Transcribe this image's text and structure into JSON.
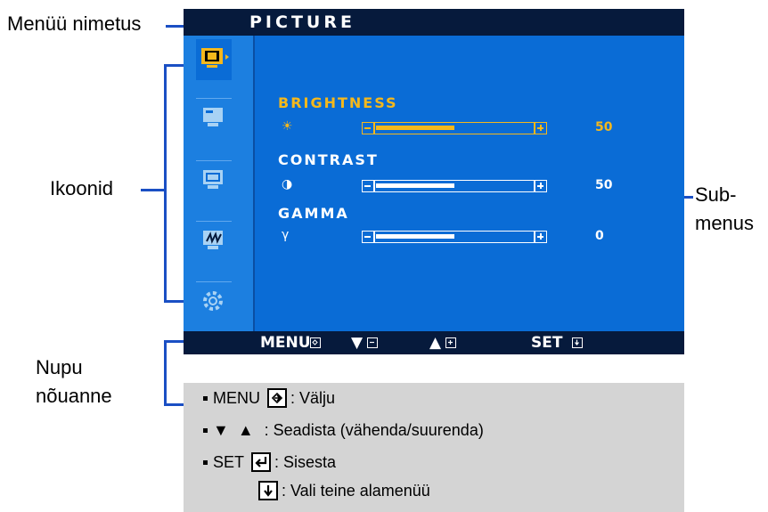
{
  "annotations": {
    "menu_name": "Menüü nimetus",
    "icons": "Ikoonid",
    "submenus": "Sub-\nmenus",
    "submenus_line1": "Sub-",
    "submenus_line2": "menus",
    "button_hint_line1": "Nupu",
    "button_hint_line2": "nõuanne"
  },
  "osd": {
    "title": "PICTURE",
    "sidebar": {
      "items": [
        {
          "icon": "picture-icon",
          "selected": true
        },
        {
          "icon": "pc-screen-icon",
          "selected": false
        },
        {
          "icon": "window-position-icon",
          "selected": false
        },
        {
          "icon": "color-tracking-icon",
          "selected": false
        },
        {
          "icon": "gear-icon",
          "selected": false
        }
      ]
    },
    "submenus": [
      {
        "label": "BRIGHTNESS",
        "icon": "sun-icon",
        "icon_glyph": "☀",
        "value": "50",
        "level": 0.5,
        "selected": true
      },
      {
        "label": "CONTRAST",
        "icon": "contrast-icon",
        "icon_glyph": "◑",
        "value": "50",
        "level": 0.5,
        "selected": false
      },
      {
        "label": "GAMMA",
        "icon": "gamma-icon",
        "icon_glyph": "γ",
        "value": "0",
        "level": 0.5,
        "selected": false
      }
    ],
    "footer": {
      "menu_label": "MENU",
      "set_label": "SET"
    }
  },
  "help": {
    "menu_key": "MENU",
    "menu_desc": ": Välju",
    "adjust_desc": ": Seadista (vähenda/suurenda)",
    "set_key": "SET",
    "set_desc": ": Sisesta",
    "down_desc": ": Vali teine alamenüü"
  },
  "colors": {
    "osd_background": "#0a6cd6",
    "osd_bar": "#061a3c",
    "selected": "#f5b81c",
    "annotation_line": "#1a4fc4",
    "help_background": "#d4d4d4"
  }
}
